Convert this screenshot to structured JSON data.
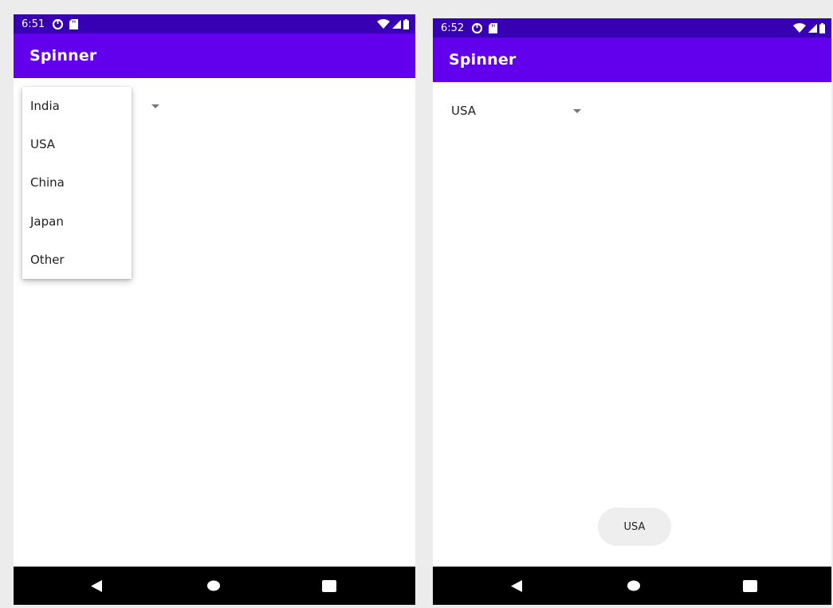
{
  "left_screen": {
    "status_time": "6:51",
    "app_title": "Spinner",
    "dropdown_items": [
      "India",
      "USA",
      "China",
      "Japan",
      "Other"
    ]
  },
  "right_screen": {
    "status_time": "6:52",
    "app_title": "Spinner",
    "spinner_value": "USA",
    "toast_text": "USA"
  },
  "icons": {
    "status_left": [
      "data-saver-icon",
      "sd-card-icon"
    ],
    "status_right": [
      "wifi-icon",
      "signal-icon",
      "battery-icon"
    ],
    "nav": [
      "back-icon",
      "home-icon",
      "recents-icon"
    ],
    "spinner": "dropdown-arrow-icon"
  },
  "colors": {
    "status_bar": "#3700b3",
    "app_bar": "#6200ee",
    "nav_bar": "#000000",
    "toast_bg": "#eeeeee"
  }
}
